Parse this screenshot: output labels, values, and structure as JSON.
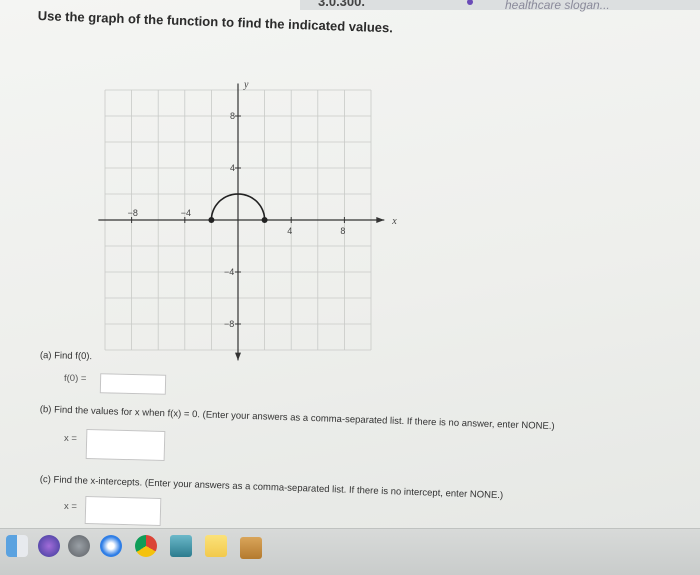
{
  "header": {
    "top_snippet": "3.0.300.",
    "top_right": "healthcare slogan...",
    "prompt": "Use the graph of the function to find the indicated values."
  },
  "graph": {
    "axis_labels": {
      "x": "x",
      "y": "y"
    },
    "x_ticks": [
      {
        "value": -8,
        "text": "−8"
      },
      {
        "value": -4,
        "text": "−4"
      },
      {
        "value": 4,
        "text": "4"
      },
      {
        "value": 8,
        "text": "8"
      }
    ],
    "y_ticks": [
      {
        "value": 8,
        "text": "8"
      },
      {
        "value": 4,
        "text": "4"
      },
      {
        "value": -4,
        "text": "−4"
      },
      {
        "value": -8,
        "text": "−8"
      }
    ],
    "x_range": [
      -10,
      10
    ],
    "y_range": [
      -10,
      10
    ],
    "curve": {
      "shape": "semicircle",
      "center": [
        0,
        0
      ],
      "radius": 2,
      "closed_endpoints": [
        [
          -2,
          0
        ],
        [
          2,
          0
        ]
      ]
    },
    "colors": {
      "grid": "#c8cac7",
      "axes": "#333333",
      "curve": "#222222"
    }
  },
  "questions": {
    "a": {
      "label": "(a)  Find f(0).",
      "eq_label": "f(0) =",
      "value": ""
    },
    "b": {
      "label": "(b)  Find the values for x when f(x) = 0. (Enter your answers as a comma-separated list. If there is no answer, enter NONE.)",
      "eq_label": "x =",
      "value": ""
    },
    "c": {
      "label": "(c)  Find the x-intercepts. (Enter your answers as a comma-separated list. If there is no intercept, enter NONE.)",
      "eq_label": "x =",
      "value": ""
    }
  },
  "dock": {
    "icons": [
      "finder-icon",
      "siri-icon",
      "launchpad-icon",
      "safari-icon",
      "chrome-icon",
      "preview-icon",
      "notes-icon",
      "folder-icon"
    ]
  }
}
